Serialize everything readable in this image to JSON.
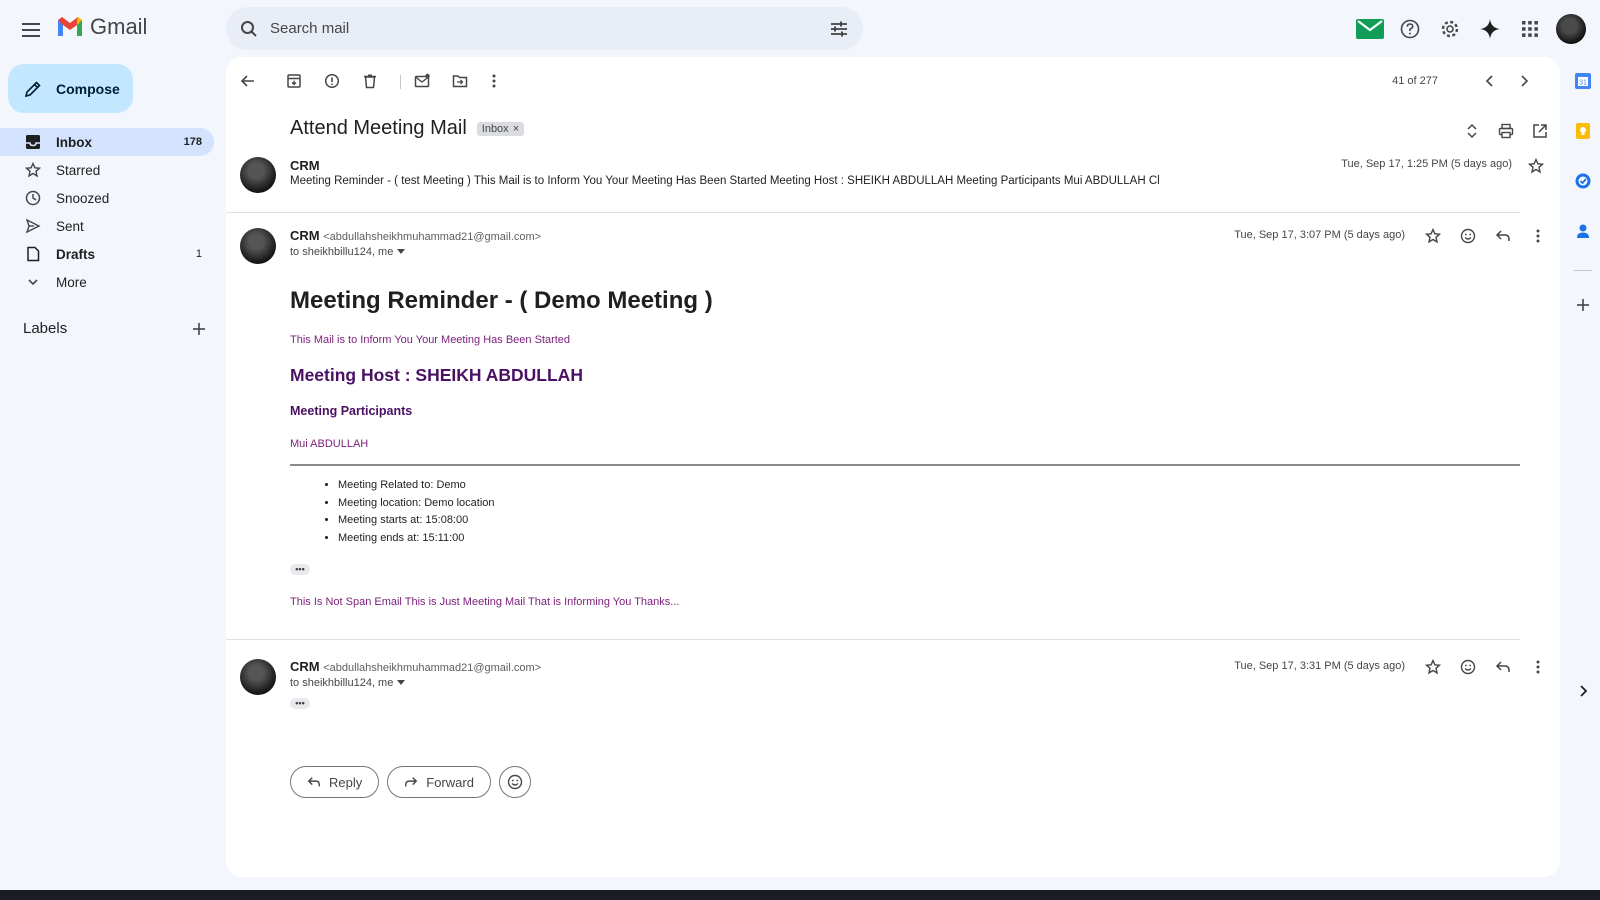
{
  "app": {
    "name": "Gmail"
  },
  "search": {
    "placeholder": "Search mail"
  },
  "compose": {
    "label": "Compose"
  },
  "nav": [
    {
      "label": "Inbox",
      "count": "178",
      "icon": "inbox-icon"
    },
    {
      "label": "Starred",
      "count": "",
      "icon": "star-icon"
    },
    {
      "label": "Snoozed",
      "count": "",
      "icon": "clock-icon"
    },
    {
      "label": "Sent",
      "count": "",
      "icon": "send-icon"
    },
    {
      "label": "Drafts",
      "count": "1",
      "icon": "draft-icon"
    },
    {
      "label": "More",
      "count": "",
      "icon": "chevron-down-icon"
    }
  ],
  "labels": {
    "title": "Labels"
  },
  "toolbar": {
    "pager": "41 of 277"
  },
  "thread": {
    "subject": "Attend Meeting Mail",
    "label_chip": "Inbox"
  },
  "messages": [
    {
      "sender": "CRM",
      "snippet": "Meeting Reminder - ( test Meeting ) This Mail is to Inform You Your Meeting Has Been Started Meeting Host : SHEIKH ABDULLAH Meeting Participants Mui ABDULLAH Cl",
      "time": "Tue, Sep 17, 1:25 PM (5 days ago)"
    },
    {
      "sender": "CRM",
      "email": "<abdullahsheikhmuhammad21@gmail.com>",
      "to": "to sheikhbillu124, me",
      "time": "Tue, Sep 17, 3:07 PM (5 days ago)",
      "body": {
        "heading": "Meeting Reminder - ( Demo Meeting )",
        "intro": "This Mail is to Inform You Your Meeting Has Been Started",
        "host": "Meeting Host : SHEIKH ABDULLAH",
        "participants_title": "Meeting Participants",
        "participants": "Mui ABDULLAH",
        "details": [
          "Meeting Related to: Demo",
          "Meeting location: Demo location",
          "Meeting starts at: 15:08:00",
          "Meeting ends at: 15:11:00"
        ],
        "footer": "This Is Not Span Email This is Just Meeting Mail That is Informing You Thanks..."
      }
    },
    {
      "sender": "CRM",
      "email": "<abdullahsheikhmuhammad21@gmail.com>",
      "to": "to sheikhbillu124, me",
      "time": "Tue, Sep 17, 3:31 PM (5 days ago)"
    }
  ],
  "actions": {
    "reply": "Reply",
    "forward": "Forward"
  },
  "colors": {
    "accent_compose": "#c2e7ff",
    "nav_active": "#d3e3fd",
    "email_purple": "#7b1e7a",
    "email_dark_purple": "#4a1064"
  }
}
